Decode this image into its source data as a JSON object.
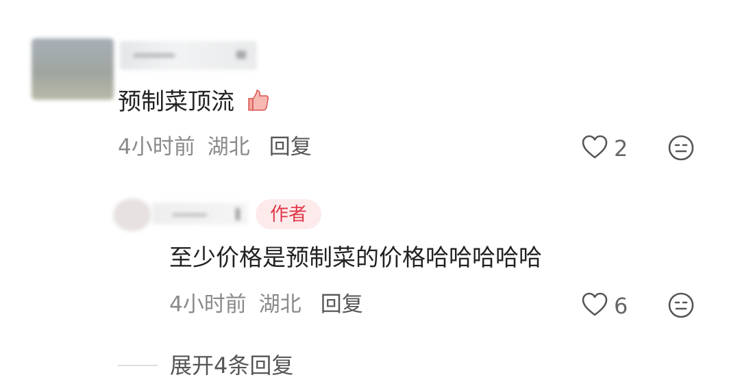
{
  "comments": [
    {
      "text": "预制菜顶流",
      "time": "4小时前",
      "location": "湖北",
      "reply_label": "回复",
      "like_count": "2",
      "emoji": "👍",
      "replies": [
        {
          "badge": "作者",
          "text": "至少价格是预制菜的价格哈哈哈哈哈",
          "time": "4小时前",
          "location": "湖北",
          "reply_label": "回复",
          "like_count": "6"
        }
      ]
    }
  ],
  "expand_label": "展开4条回复",
  "icons": {
    "like": "heart-outline-icon",
    "dislike": "neutral-face-icon",
    "thumb": "thumbs-up-emoji"
  },
  "colors": {
    "author_badge_bg": "#fdebec",
    "author_badge_text": "#e0394a",
    "meta": "#8a8a8a"
  }
}
